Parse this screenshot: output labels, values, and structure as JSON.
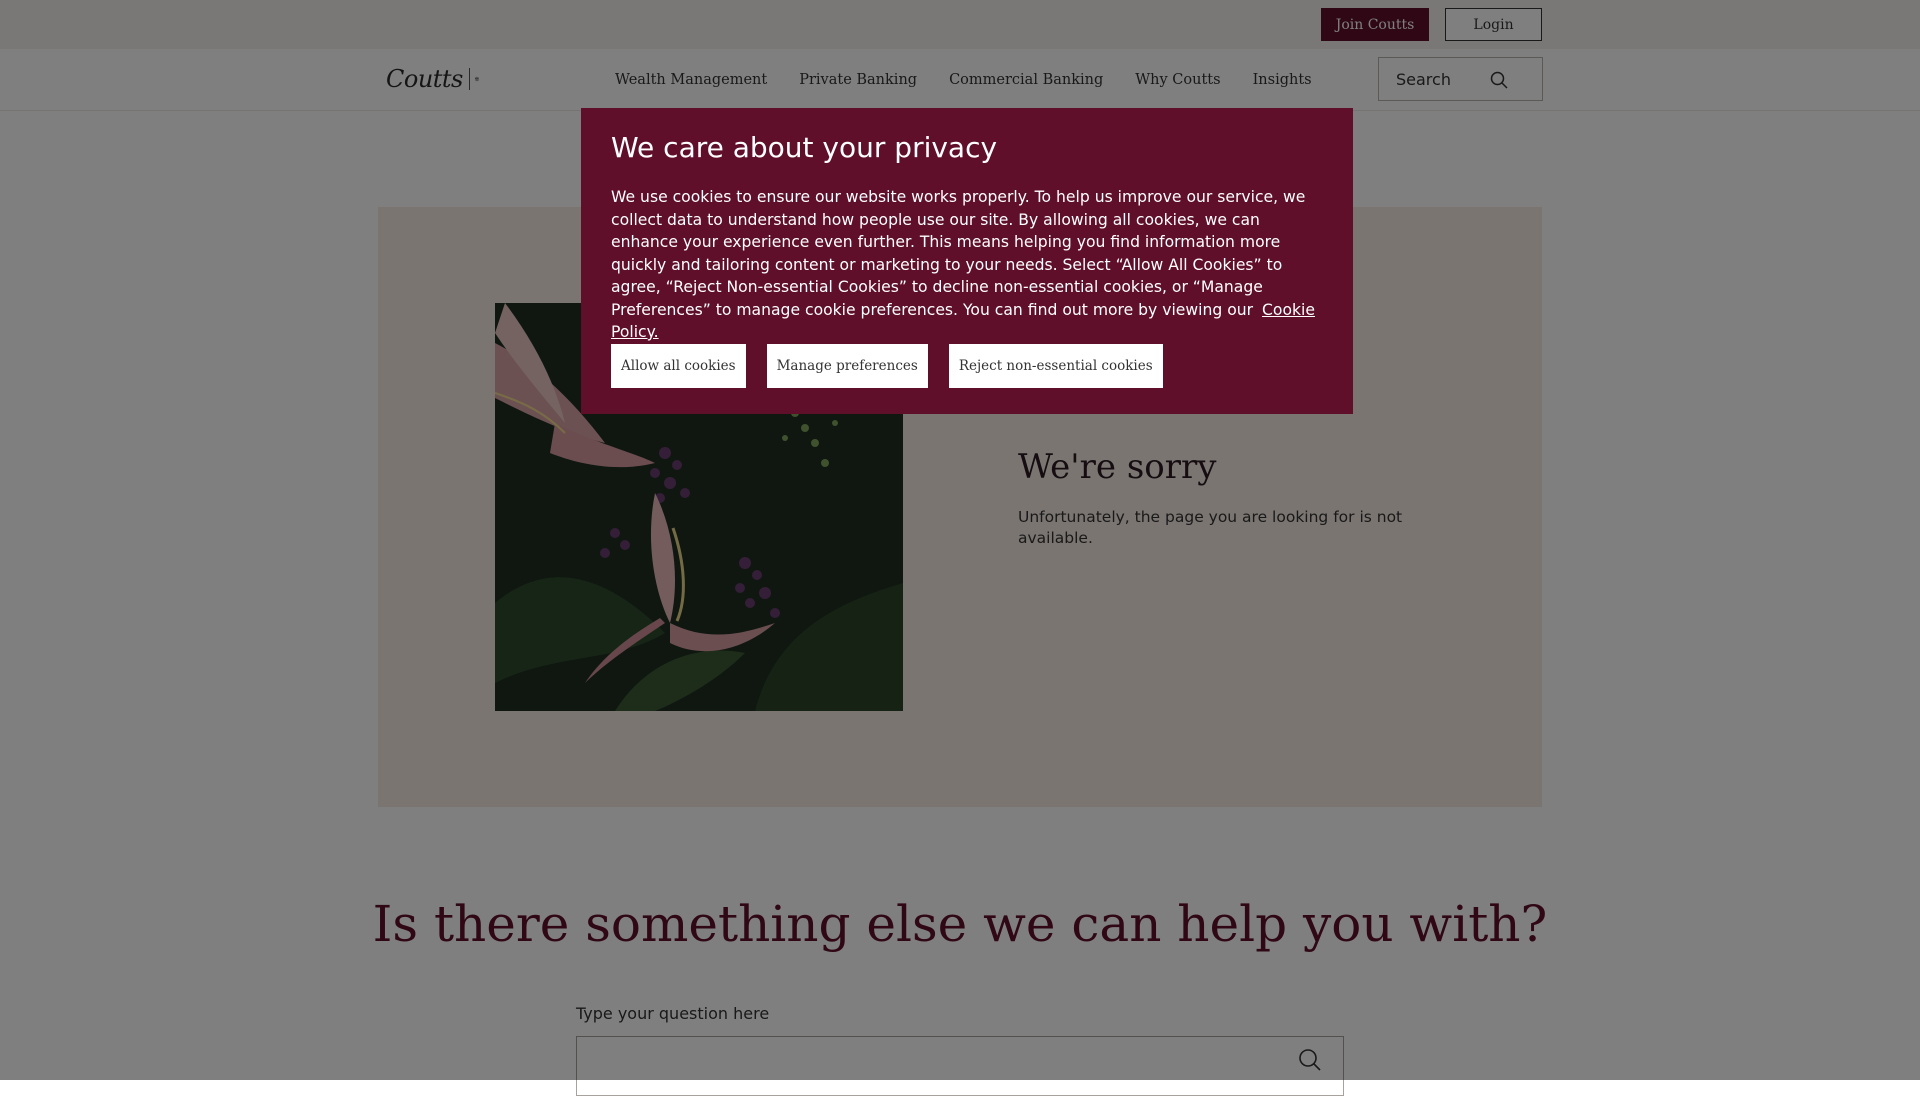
{
  "header": {
    "join_label": "Join Coutts",
    "login_label": "Login"
  },
  "nav": {
    "logo_text": "Coutts",
    "items": [
      {
        "label": "Wealth Management"
      },
      {
        "label": "Private Banking"
      },
      {
        "label": "Commercial Banking"
      },
      {
        "label": "Why Coutts"
      },
      {
        "label": "Insights"
      }
    ],
    "search_label": "Search",
    "search_icon": "magnifier-icon"
  },
  "error": {
    "image_description_icon": "flowers-image",
    "title": "We're sorry",
    "message": "Unfortunately, the page you are looking for is not available."
  },
  "help": {
    "heading": "Is there something else we can help you with?",
    "question_label": "Type your question here",
    "question_value": "",
    "search_icon": "magnifier-icon"
  },
  "cookie_dialog": {
    "title": "We care about your privacy",
    "body": "We use cookies to ensure our website works properly. To help us improve our service, we collect data to understand how people use our site. By allowing all cookies, we can enhance your experience even further. This means helping you find information more quickly and tailoring content or marketing to your needs. Select “Allow All Cookies” to agree, “Reject Non-essential Cookies” to decline non-essential cookies, or “Manage Preferences” to manage cookie preferences. You can find out more by viewing our",
    "policy_link": "Cookie Policy.",
    "buttons": {
      "allow_all": "Allow all cookies",
      "manage": "Manage preferences",
      "reject": "Reject non-essential cookies"
    }
  },
  "colors": {
    "brand": "#5f0f2a",
    "card_background": "#f4eae3",
    "utility_bar": "#f5f0ec",
    "overlay": "rgba(0,0,0,0.5)"
  }
}
